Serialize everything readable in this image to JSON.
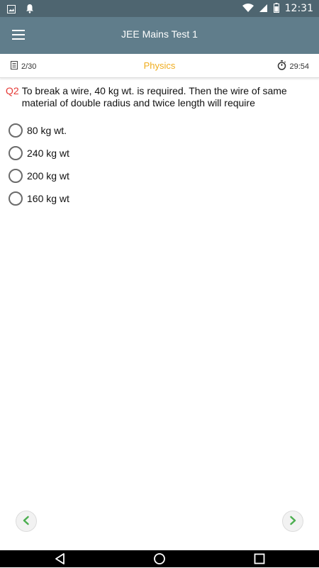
{
  "status_bar": {
    "time": "12:31",
    "icons": [
      "image-icon",
      "notification-bell-icon",
      "wifi-icon",
      "signal-icon",
      "battery-icon"
    ]
  },
  "app_bar": {
    "title": "JEE Mains Test 1",
    "menu_icon": "hamburger-menu-icon",
    "background": "#607d8b"
  },
  "info_bar": {
    "question_count": "2/30",
    "subject": "Physics",
    "subject_color": "#f0ad1e",
    "timer": "29:54"
  },
  "question": {
    "number": "Q2",
    "text": "To break a wire, 40 kg wt. is required. Then the wire of same material of double radius and twice length will require",
    "number_color": "#e53935"
  },
  "options": [
    {
      "label": "80 kg wt."
    },
    {
      "label": "240 kg wt"
    },
    {
      "label": "200 kg wt"
    },
    {
      "label": "160 kg wt"
    }
  ],
  "navigation": {
    "prev_icon": "chevron-left-icon",
    "next_icon": "chevron-right-icon",
    "accent": "#4caf50"
  },
  "system_nav": {
    "icons": [
      "back-icon",
      "home-icon",
      "recents-icon"
    ]
  }
}
